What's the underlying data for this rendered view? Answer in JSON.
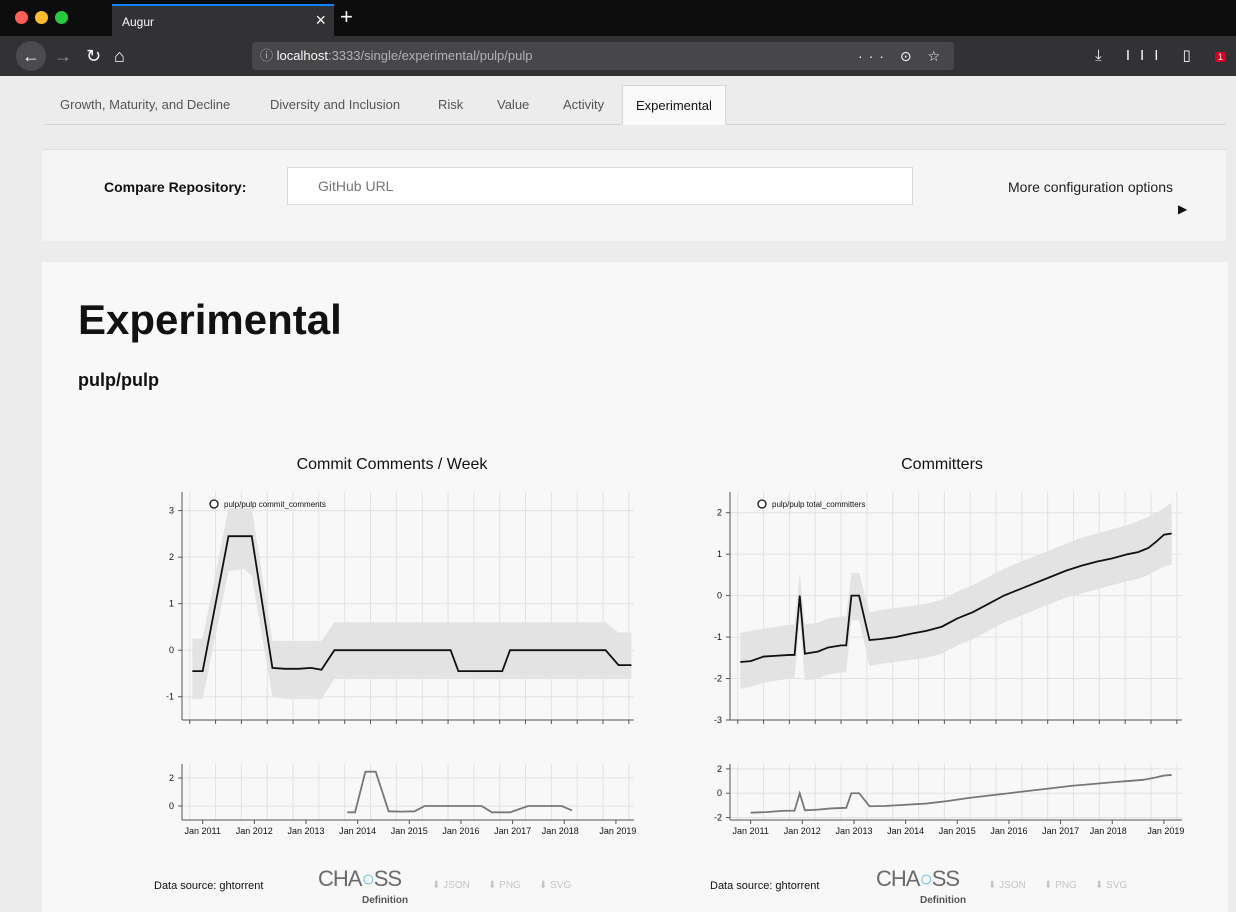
{
  "browser": {
    "tab_title": "Augur",
    "tab_close": "×",
    "new_tab": "+",
    "url_host": "localhost",
    "url_path": ":3333/single/experimental/pulp/pulp",
    "url_info": "ⓘ",
    "url_actions": "··· ⊙ ☆",
    "right_icons": "⤓ III ▯",
    "badge": "1"
  },
  "nav_tabs": [
    {
      "label": "Growth, Maturity, and Decline"
    },
    {
      "label": "Diversity and Inclusion"
    },
    {
      "label": "Risk"
    },
    {
      "label": "Value"
    },
    {
      "label": "Activity"
    },
    {
      "label": "Experimental"
    }
  ],
  "compare": {
    "label": "Compare Repository:",
    "placeholder": "GitHub URL",
    "more_options": "More configuration options",
    "arrow": "▶"
  },
  "page": {
    "title": "Experimental",
    "repo": "pulp/pulp"
  },
  "charts": [
    {
      "title": "Commit Comments / Week",
      "legend": "pulp/pulp commit_comments",
      "data_source": "Data source: ghtorrent"
    },
    {
      "title": "Committers",
      "legend": "pulp/pulp total_committers",
      "data_source": "Data source: ghtorrent"
    }
  ],
  "downloads": {
    "json": "⬇ JSON",
    "png": "⬇ PNG",
    "svg": "⬇ SVG"
  },
  "chaoss": {
    "text_a": "CHA",
    "text_b": "SS",
    "def": "Definition"
  },
  "chart_data": [
    {
      "type": "line",
      "title": "Commit Comments / Week",
      "x_ticks": [
        "Jan 2011",
        "Jan 2012",
        "Jan 2013",
        "Jan 2014",
        "Jan 2015",
        "Jan 2016",
        "Jan 2017",
        "Jan 2018",
        "Jan 2019"
      ],
      "ylim": [
        -1.5,
        3.4
      ],
      "y_ticks": [
        -1,
        0,
        1,
        2,
        3
      ],
      "series": [
        {
          "name": "pulp/pulp commit_comments",
          "x": [
            2010.8,
            2011.0,
            2011.5,
            2011.8,
            2011.95,
            2012.35,
            2012.6,
            2012.85,
            2013.1,
            2013.3,
            2013.55,
            2013.8,
            2014.05,
            2014.3,
            2014.55,
            2014.8,
            2015.05,
            2015.3,
            2015.55,
            2015.8,
            2015.95,
            2016.3,
            2016.55,
            2016.8,
            2016.95,
            2017.3,
            2017.55,
            2017.8,
            2018.05,
            2018.3,
            2018.55,
            2018.8,
            2019.05,
            2019.3
          ],
          "y": [
            -0.45,
            -0.45,
            2.45,
            2.45,
            2.45,
            -0.38,
            -0.4,
            -0.4,
            -0.38,
            -0.42,
            0,
            0,
            0,
            0,
            0,
            0,
            0,
            0,
            0,
            0,
            -0.45,
            -0.45,
            -0.45,
            -0.45,
            0,
            0,
            0,
            0,
            0,
            0,
            0,
            0,
            -0.32,
            -0.32
          ]
        }
      ],
      "band_lower": [
        -1.05,
        -1.05,
        1.7,
        1.75,
        1.6,
        -1.0,
        -1.05,
        -1.05,
        -1.05,
        -1.05,
        -0.62,
        -0.62,
        -0.62,
        -0.62,
        -0.62,
        -0.62,
        -0.62,
        -0.62,
        -0.62,
        -0.62,
        -0.62,
        -0.62,
        -0.62,
        -0.62,
        -0.62,
        -0.62,
        -0.62,
        -0.62,
        -0.62,
        -0.62,
        -0.62,
        -0.62,
        -0.62,
        -0.62
      ],
      "band_upper": [
        0.25,
        0.25,
        3.05,
        3.05,
        3.05,
        0.2,
        0.2,
        0.2,
        0.2,
        0.2,
        0.6,
        0.6,
        0.6,
        0.6,
        0.6,
        0.6,
        0.6,
        0.6,
        0.6,
        0.6,
        0.6,
        0.6,
        0.6,
        0.6,
        0.6,
        0.6,
        0.6,
        0.6,
        0.6,
        0.6,
        0.6,
        0.6,
        0.38,
        0.38
      ],
      "overview": {
        "y_ticks": [
          0,
          2
        ],
        "ylim": [
          -1,
          3
        ],
        "x": [
          2013.8,
          2013.95,
          2014.15,
          2014.35,
          2014.6,
          2014.85,
          2015.1,
          2015.3,
          2015.6,
          2016.0,
          2016.4,
          2016.6,
          2016.95,
          2017.3,
          2017.6,
          2017.95,
          2018.15
        ],
        "y": [
          -0.45,
          -0.45,
          2.45,
          2.45,
          -0.38,
          -0.4,
          -0.38,
          0,
          0,
          0,
          0,
          -0.45,
          -0.45,
          0,
          0,
          0,
          -0.32
        ]
      }
    },
    {
      "type": "line",
      "title": "Committers",
      "x_ticks": [
        "Jan 2011",
        "Jan 2012",
        "Jan 2013",
        "Jan 2014",
        "Jan 2015",
        "Jan 2016",
        "Jan 2017",
        "Jan 2018",
        "Jan 2019"
      ],
      "ylim": [
        -3,
        2.5
      ],
      "y_ticks": [
        -3,
        -2,
        -1,
        0,
        1,
        2
      ],
      "series": [
        {
          "name": "pulp/pulp total_committers",
          "x": [
            2010.8,
            2011.0,
            2011.25,
            2011.5,
            2011.75,
            2011.85,
            2011.95,
            2012.05,
            2012.3,
            2012.5,
            2012.75,
            2012.85,
            2012.95,
            2013.1,
            2013.3,
            2013.5,
            2013.8,
            2014.1,
            2014.4,
            2014.7,
            2015.0,
            2015.3,
            2015.6,
            2015.9,
            2016.2,
            2016.5,
            2016.8,
            2017.1,
            2017.4,
            2017.7,
            2018.0,
            2018.3,
            2018.5,
            2018.7,
            2018.85,
            2019.0,
            2019.15
          ],
          "y": [
            -1.6,
            -1.58,
            -1.47,
            -1.45,
            -1.43,
            -1.43,
            0.0,
            -1.4,
            -1.35,
            -1.25,
            -1.2,
            -1.2,
            0.0,
            0.0,
            -1.07,
            -1.05,
            -1.0,
            -0.92,
            -0.85,
            -0.75,
            -0.55,
            -0.4,
            -0.2,
            0.0,
            0.15,
            0.3,
            0.45,
            0.6,
            0.72,
            0.82,
            0.9,
            1.0,
            1.05,
            1.15,
            1.3,
            1.47,
            1.5
          ]
        }
      ],
      "band_lower": [
        -2.25,
        -2.2,
        -2.1,
        -2.05,
        -2.0,
        -2.0,
        -0.6,
        -2.05,
        -2.0,
        -1.9,
        -1.85,
        -1.85,
        -0.6,
        -0.6,
        -1.7,
        -1.65,
        -1.6,
        -1.55,
        -1.5,
        -1.4,
        -1.2,
        -1.05,
        -0.85,
        -0.65,
        -0.5,
        -0.35,
        -0.2,
        -0.05,
        0.05,
        0.15,
        0.25,
        0.35,
        0.4,
        0.5,
        0.6,
        0.7,
        0.75
      ],
      "band_upper": [
        -0.9,
        -0.85,
        -0.8,
        -0.75,
        -0.7,
        -0.7,
        0.55,
        -0.7,
        -0.65,
        -0.55,
        -0.5,
        -0.5,
        0.55,
        0.55,
        -0.4,
        -0.35,
        -0.3,
        -0.25,
        -0.2,
        -0.1,
        0.1,
        0.25,
        0.45,
        0.65,
        0.8,
        0.95,
        1.1,
        1.25,
        1.4,
        1.5,
        1.6,
        1.7,
        1.8,
        1.9,
        2.0,
        2.1,
        2.25
      ],
      "overview": {
        "y_ticks": [
          -2,
          0,
          2
        ],
        "ylim": [
          -2.2,
          2.4
        ],
        "x": [
          2011.0,
          2011.3,
          2011.6,
          2011.85,
          2011.95,
          2012.05,
          2012.3,
          2012.55,
          2012.85,
          2012.95,
          2013.1,
          2013.3,
          2013.6,
          2014.0,
          2014.4,
          2014.8,
          2015.2,
          2015.6,
          2016.0,
          2016.4,
          2016.8,
          2017.2,
          2017.6,
          2018.0,
          2018.3,
          2018.6,
          2018.85,
          2019.0,
          2019.15
        ],
        "y": [
          -1.6,
          -1.55,
          -1.45,
          -1.43,
          0.0,
          -1.4,
          -1.35,
          -1.25,
          -1.2,
          0.0,
          0.0,
          -1.07,
          -1.05,
          -0.95,
          -0.85,
          -0.65,
          -0.4,
          -0.2,
          0.0,
          0.2,
          0.4,
          0.6,
          0.75,
          0.9,
          1.0,
          1.1,
          1.3,
          1.45,
          1.5
        ]
      }
    }
  ]
}
